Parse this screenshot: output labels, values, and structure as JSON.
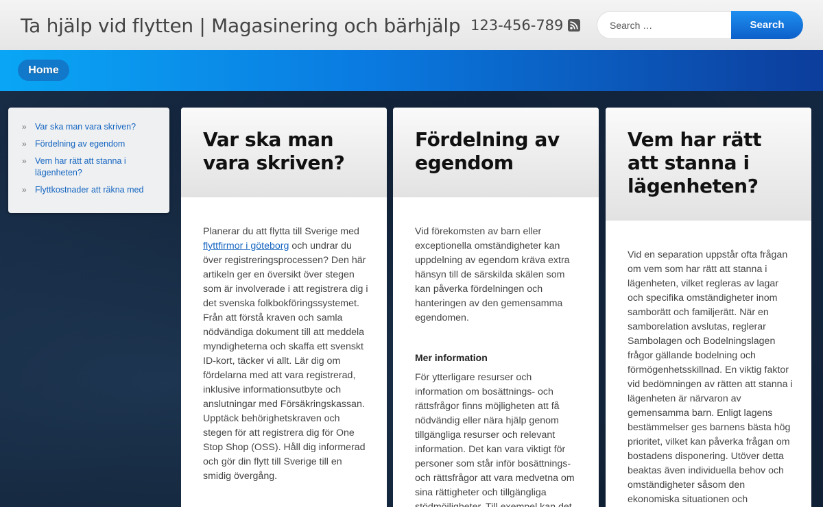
{
  "header": {
    "site_title": "Ta hjälp vid flytten | Magasinering och bärhjälp",
    "phone": "123-456-789",
    "rss_icon": "rss-icon",
    "search": {
      "placeholder": "Search …",
      "button_label": "Search"
    }
  },
  "nav": {
    "home_label": "Home"
  },
  "sidebar": {
    "items": [
      {
        "label": "Var ska man vara skriven?"
      },
      {
        "label": "Fördelning av egendom"
      },
      {
        "label": "Vem har rätt att stanna i lägenheten?"
      },
      {
        "label": "Flyttkostnader att räkna med"
      }
    ]
  },
  "cards": [
    {
      "title": "Var ska man vara skriven?",
      "intro_before_link": "Planerar du att flytta till Sverige med ",
      "link_text": "flyttfirmor i göteborg",
      "intro_after_link": " och undrar du över registreringsprocessen? Den här artikeln ger en översikt över stegen som är involverade i att registrera dig i det svenska folkbokföringssystemet. Från att förstå kraven och samla nödvändiga dokument till att meddela myndigheterna och skaffa ett svenskt ID-kort, täcker vi allt. Lär dig om fördelarna med att vara registrerad, inklusive informationsutbyte och anslutningar med Försäkringskassan. Upptäck behörighetskraven och stegen för att registrera dig för One Stop Shop (OSS). Håll dig informerad och gör din flytt till Sverige till en smidig övergång."
    },
    {
      "title": "Fördelning av egendom",
      "intro": "Vid förekomsten av barn eller exceptionella omständigheter kan uppdelning av egendom kräva extra hänsyn till de särskilda skälen som kan påverka fördelningen och hanteringen av den gemensamma egendomen.",
      "subheading": "Mer information",
      "body": "För ytterligare resurser och information om bosättnings- och rättsfrågor finns möjligheten att få nödvändig eller nära hjälp genom tillgängliga resurser och relevant information. Det kan vara viktigt för personer som står inför bosättnings- och rättsfrågor att vara medvetna om sina rättigheter och tillgängliga stödmöjligheter. Till exempel kan det"
    },
    {
      "title": "Vem har rätt att stanna i lägenheten?",
      "intro": "Vid en separation uppstår ofta frågan om vem som har rätt att stanna i lägenheten, vilket regleras av lagar och specifika omständigheter inom samborätt och familjerätt. När en samborelation avslutas, reglerar Sambolagen och Bodelningslagen frågor gällande bodelning och förmögenhetsskillnad. En viktig faktor vid bedömningen av rätten att stanna i lägenheten är närvaron av gemensamma barn. Enligt lagens bestämmelser ges barnens bästa hög prioritet, vilket kan påverka frågan om bostadens disponering. Utöver detta beaktas även individuella behov och omständigheter såsom den ekonomiska situationen och"
    }
  ]
}
